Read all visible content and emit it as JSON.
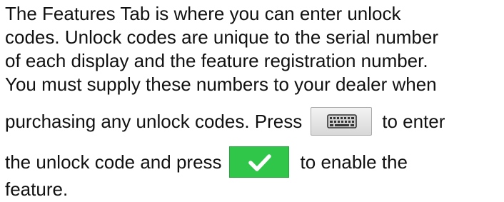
{
  "paragraph": {
    "line1": "The Features Tab is where you can enter unlock",
    "line2": "codes. Unlock codes are unique to the serial number",
    "line3": "of each display and the feature registration number.",
    "line4": "You must supply these numbers to your dealer when",
    "line5_before": "purchasing any unlock codes. Press",
    "line5_after": "to enter",
    "line6_before": "the unlock code and press",
    "line6_after": "to enable the",
    "line7": "feature."
  },
  "icons": {
    "keyboard": "keyboard-icon",
    "accept": "checkmark-icon"
  },
  "colors": {
    "accept_button": "#2fc64a",
    "keyboard_button": "#e6e6e6"
  }
}
